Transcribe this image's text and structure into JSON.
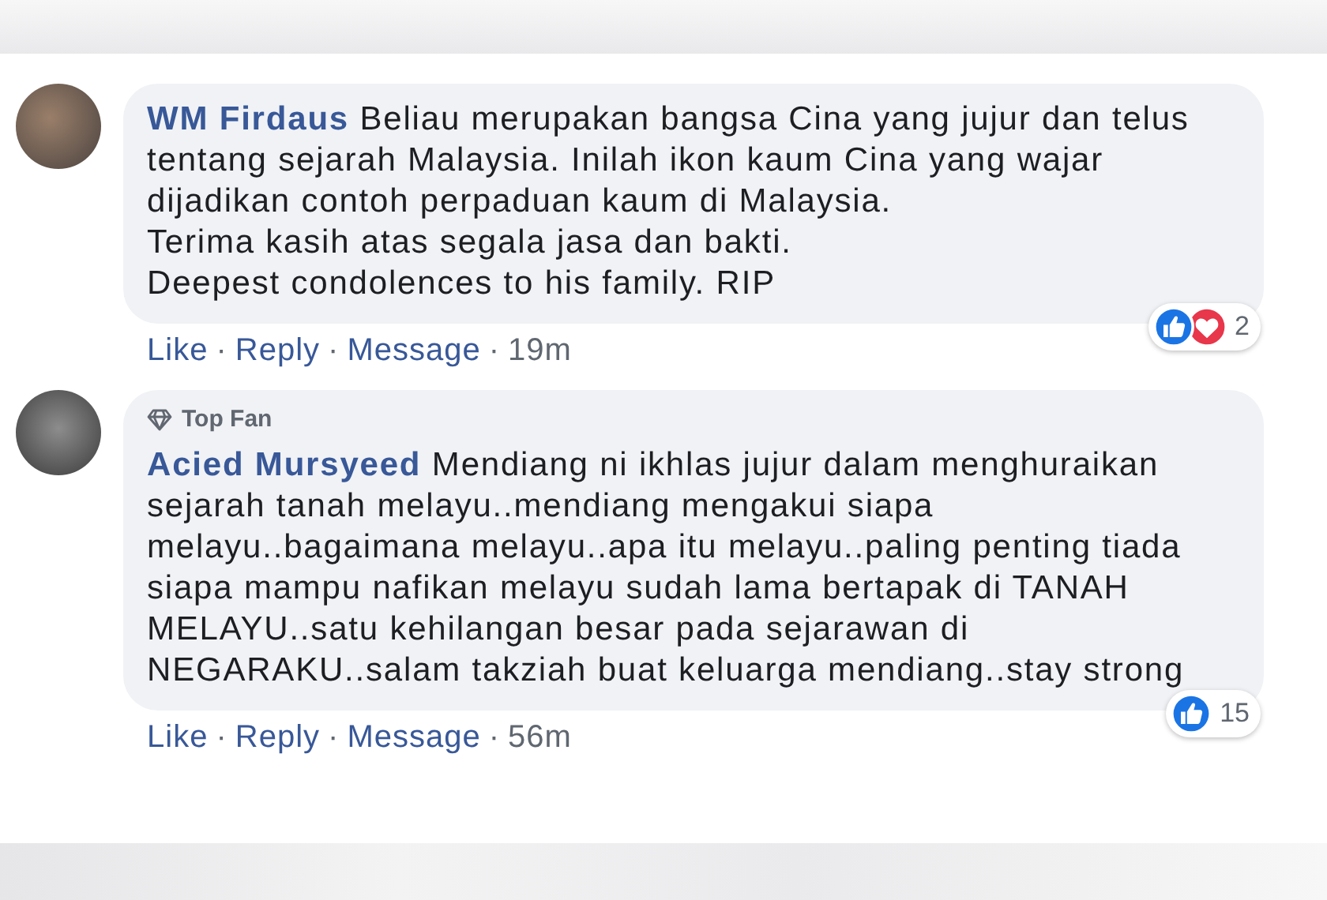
{
  "comments": [
    {
      "author": "WM Firdaus",
      "text": "Beliau merupakan bangsa Cina yang jujur dan telus tentang sejarah Malaysia. Inilah ikon kaum Cina yang wajar dijadikan contoh perpaduan kaum di Malaysia.\nTerima kasih atas segala jasa dan bakti.\nDeepest condolences to his family. RIP",
      "reactions": {
        "icons": [
          {
            "kind": "like"
          },
          {
            "kind": "love"
          }
        ],
        "count": "2"
      },
      "actions": [
        "Like",
        "Reply",
        "Message"
      ],
      "separator": "·",
      "time": "19m"
    },
    {
      "author": "Acied Mursyeed",
      "badge": {
        "label": "Top Fan"
      },
      "text": "Mendiang ni ikhlas jujur dalam menghuraikan sejarah tanah melayu..mendiang mengakui siapa melayu..bagaimana melayu..apa itu melayu..paling penting tiada siapa mampu nafikan melayu sudah lama bertapak di TANAH MELAYU..satu kehilangan besar pada sejarawan di NEGARAKU..salam takziah buat keluarga mendiang..stay strong",
      "reactions": {
        "icons": [
          {
            "kind": "like"
          }
        ],
        "count": "15"
      },
      "actions": [
        "Like",
        "Reply",
        "Message"
      ],
      "separator": "·",
      "time": "56m"
    }
  ]
}
